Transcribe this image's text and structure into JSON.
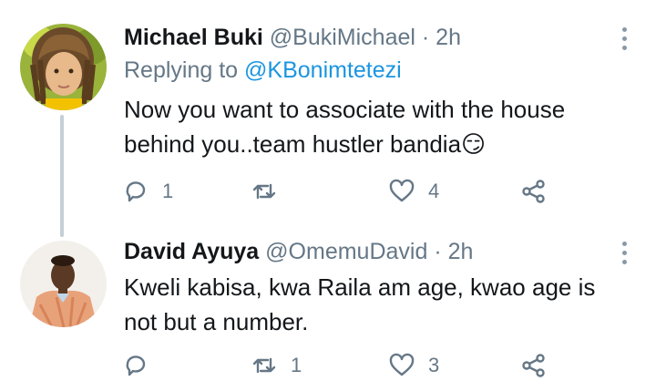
{
  "tweets": [
    {
      "name": "Michael Buki",
      "handle": "@BukiMichael",
      "time": "2h",
      "replying_prefix": "Replying to",
      "replying_to": "@KBonimtetezi",
      "text_line1": "Now you want to associate with the house",
      "text_line2": "behind you..team hustler bandia😏",
      "replies": "1",
      "retweets": "",
      "likes": "4"
    },
    {
      "name": "David Ayuya",
      "handle": "@OmemuDavid",
      "time": "2h",
      "text_line1": "Kweli kabisa, kwa Raila am age, kwao age is",
      "text_line2": "not but a number.",
      "replies": "",
      "retweets": "1",
      "likes": "3"
    }
  ],
  "separator": "·",
  "icons": [
    "reply-icon",
    "retweet-icon",
    "like-icon",
    "share-icon",
    "more-icon"
  ],
  "colors": {
    "link": "#1b95e0",
    "muted": "#657786",
    "text": "#14171a"
  }
}
